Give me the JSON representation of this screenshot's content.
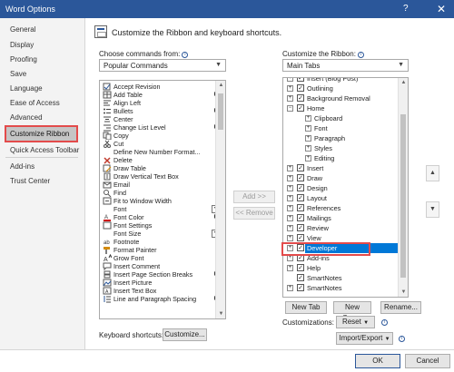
{
  "window": {
    "title": "Word Options",
    "help": "?",
    "close": "✕"
  },
  "nav": {
    "items": [
      "General",
      "Display",
      "Proofing",
      "Save",
      "Language",
      "Ease of Access",
      "Advanced",
      "Customize Ribbon",
      "Quick Access Toolbar",
      "Add-ins",
      "Trust Center"
    ],
    "selected": "Customize Ribbon"
  },
  "header": {
    "title": "Customize the Ribbon and keyboard shortcuts."
  },
  "left_panel": {
    "label": "Choose commands from:",
    "selected": "Popular Commands",
    "commands": [
      "Accept Revision",
      "Add Table",
      "Align Left",
      "Bullets",
      "Center",
      "Change List Level",
      "Copy",
      "Cut",
      "Define New Number Format...",
      "Delete",
      "Draw Table",
      "Draw Vertical Text Box",
      "Email",
      "Find",
      "Fit to Window Width",
      "Font",
      "Font Color",
      "Font Settings",
      "Font Size",
      "Footnote",
      "Format Painter",
      "Grow Font",
      "Insert Comment",
      "Insert Page  Section Breaks",
      "Insert Picture",
      "Insert Text Box",
      "Line and Paragraph Spacing"
    ]
  },
  "middle": {
    "add": "Add >>",
    "remove": "<< Remove"
  },
  "right_panel": {
    "label": "Customize the Ribbon:",
    "selected": "Main Tabs",
    "tree": [
      {
        "label": "Insert (Blog Post)",
        "level": 0
      },
      {
        "label": "Outlining",
        "level": 0
      },
      {
        "label": "Background Removal",
        "level": 0
      },
      {
        "label": "Home",
        "level": 0,
        "expanded": true
      },
      {
        "label": "Clipboard",
        "level": 1
      },
      {
        "label": "Font",
        "level": 1
      },
      {
        "label": "Paragraph",
        "level": 1
      },
      {
        "label": "Styles",
        "level": 1
      },
      {
        "label": "Editing",
        "level": 1
      },
      {
        "label": "Insert",
        "level": 0
      },
      {
        "label": "Draw",
        "level": 0
      },
      {
        "label": "Design",
        "level": 0
      },
      {
        "label": "Layout",
        "level": 0
      },
      {
        "label": "References",
        "level": 0
      },
      {
        "label": "Mailings",
        "level": 0
      },
      {
        "label": "Review",
        "level": 0
      },
      {
        "label": "View",
        "level": 0
      },
      {
        "label": "Developer",
        "level": 0,
        "selected": true
      },
      {
        "label": "Add-ins",
        "level": 0
      },
      {
        "label": "Help",
        "level": 0
      },
      {
        "label": "SmartNotes",
        "level": 0,
        "no_expander": true
      },
      {
        "label": "SmartNotes",
        "level": 0
      }
    ],
    "new_tab": "New Tab",
    "new_group": "New Group",
    "rename": "Rename...",
    "customizations_label": "Customizations:",
    "reset": "Reset",
    "import_export": "Import/Export"
  },
  "keyboard": {
    "label": "Keyboard shortcuts:",
    "button": "Customize..."
  },
  "footer": {
    "ok": "OK",
    "cancel": "Cancel"
  },
  "colors": {
    "titlebar": "#2b579a",
    "selection": "#0078d7",
    "highlight_box": "#e34b4b"
  }
}
